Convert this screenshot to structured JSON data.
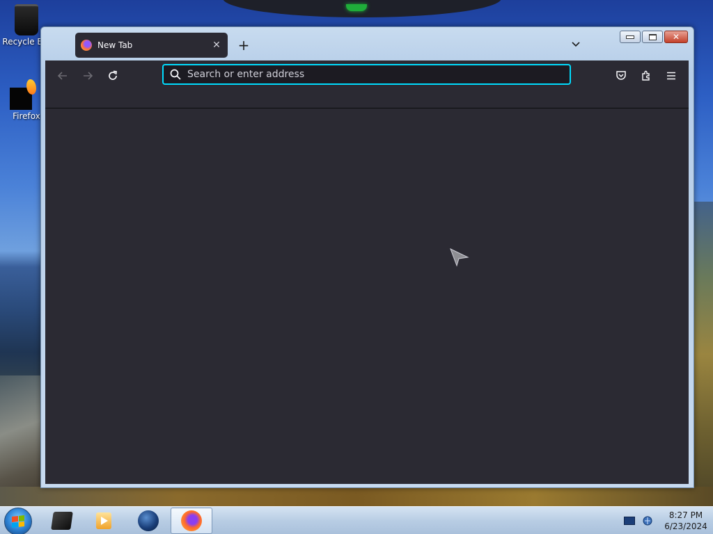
{
  "desktop": {
    "icons": [
      {
        "label": "Recycle Bin"
      },
      {
        "label": "Firefox"
      }
    ]
  },
  "browser": {
    "tab": {
      "title": "New Tab",
      "close_icon": "close-icon"
    },
    "new_tab_symbol": "+",
    "urlbar": {
      "placeholder": "Search or enter address",
      "value": ""
    },
    "accent": "#00ddff",
    "toolbar_bg": "#2b2a33",
    "content_bg": "#2b2a33"
  },
  "taskbar": {
    "items": [
      {
        "name": "start"
      },
      {
        "name": "app-box"
      },
      {
        "name": "media-player"
      },
      {
        "name": "globe-app"
      },
      {
        "name": "firefox",
        "active": true
      }
    ],
    "clock": {
      "time": "8:27 PM",
      "date": "6/23/2024"
    }
  }
}
